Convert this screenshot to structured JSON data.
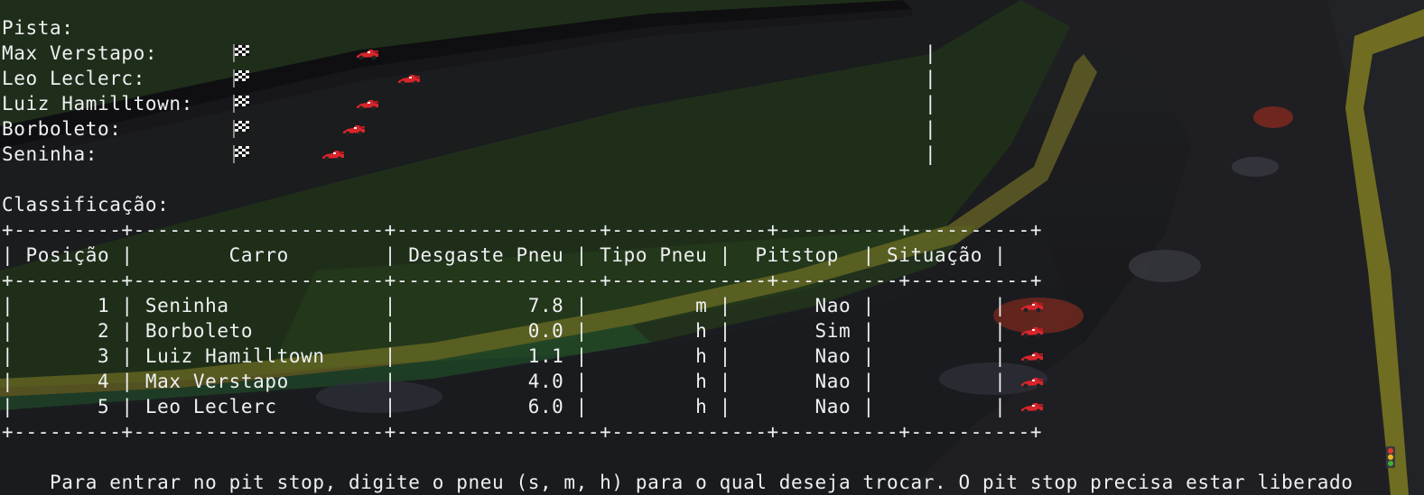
{
  "track": {
    "heading": "Pista:",
    "drivers": [
      {
        "label": "Max Verstapo:",
        "flag_icon": "checkered-flag-icon",
        "car_icon": "race-car-icon",
        "progress": 0.18
      },
      {
        "label": "Leo Leclerc:",
        "flag_icon": "checkered-flag-icon",
        "car_icon": "race-car-icon",
        "progress": 0.24
      },
      {
        "label": "Luiz Hamilltown:",
        "flag_icon": "checkered-flag-icon",
        "car_icon": "race-car-icon",
        "progress": 0.18
      },
      {
        "label": "Borboleto:",
        "flag_icon": "checkered-flag-icon",
        "car_icon": "race-car-icon",
        "progress": 0.16
      },
      {
        "label": "Seninha:",
        "flag_icon": "checkered-flag-icon",
        "car_icon": "race-car-icon",
        "progress": 0.13
      }
    ],
    "finish_marker": "|"
  },
  "classification": {
    "heading": "Classificação:",
    "border": "+---------+---------------------+-----------------+-------------+----------+----------+",
    "header_line": "| Posição |        Carro        | Desgaste Pneu | Tipo Pneu |  Pitstop  | Situação |",
    "columns": [
      "Posição",
      "Carro",
      "Desgaste Pneu",
      "Tipo Pneu",
      "Pitstop",
      "Situação"
    ],
    "rows": [
      {
        "line": "|       1 | Seninha             |           7.8 |         m |       Nao |          |",
        "position": "1",
        "car": "Seninha",
        "wear": "7.8",
        "tire": "m",
        "pitstop": "Nao",
        "status_icon": "race-car-icon"
      },
      {
        "line": "|       2 | Borboleto           |           0.0 |         h |       Sim |          |",
        "position": "2",
        "car": "Borboleto",
        "wear": "0.0",
        "tire": "h",
        "pitstop": "Sim",
        "status_icon": "race-car-icon"
      },
      {
        "line": "|       3 | Luiz Hamilltown     |           1.1 |         h |       Nao |          |",
        "position": "3",
        "car": "Luiz Hamilltown",
        "wear": "1.1",
        "tire": "h",
        "pitstop": "Nao",
        "status_icon": "race-car-icon"
      },
      {
        "line": "|       4 | Max Verstapo        |           4.0 |         h |       Nao |          |",
        "position": "4",
        "car": "Max Verstapo",
        "wear": "4.0",
        "tire": "h",
        "pitstop": "Nao",
        "status_icon": "race-car-icon"
      },
      {
        "line": "|       5 | Leo Leclerc         |           6.0 |         h |       Nao |          |",
        "position": "5",
        "car": "Leo Leclerc",
        "wear": "6.0",
        "tire": "h",
        "pitstop": "Nao",
        "status_icon": "race-car-icon"
      }
    ]
  },
  "prompt": {
    "text": "Para entrar no pit stop, digite o pneu (s, m, h) para o qual deseja trocar. O pit stop precisa estar liberado",
    "icon": "traffic-light-icon"
  },
  "colors": {
    "text": "#eef0f2",
    "car_red": "#d8252b",
    "grass": "#2e4a22",
    "asphalt": "#2a2b30",
    "kerb_yellow": "#c9c23a",
    "kerb_green": "#3a7a3a"
  }
}
